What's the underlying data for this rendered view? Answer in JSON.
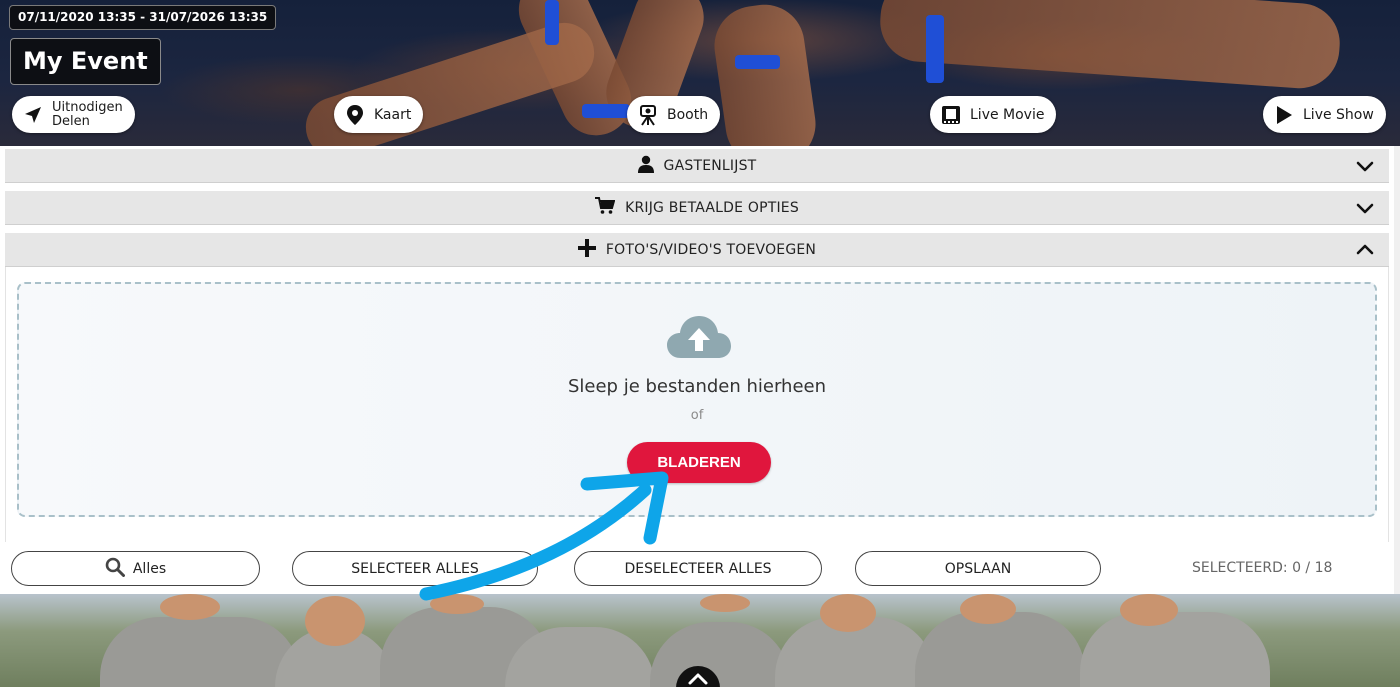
{
  "header": {
    "date_range": "07/11/2020 13:35 - 31/07/2026 13:35",
    "event_title": "My Event",
    "actions": {
      "invite_line1": "Uitnodigen",
      "invite_line2": "Delen",
      "map": "Kaart",
      "booth": "Booth",
      "live_movie": "Live Movie",
      "live_show": "Live Show"
    },
    "icons": {
      "invite": "paper-plane-icon",
      "map": "map-pin-icon",
      "booth": "camera-tripod-icon",
      "live_movie": "film-icon",
      "live_show": "play-icon"
    }
  },
  "accordion": {
    "guestlist": {
      "label": "GASTENLIJST",
      "icon": "user-icon",
      "expanded": false
    },
    "paid_options": {
      "label": "KRIJG BETAALDE OPTIES",
      "icon": "cart-icon",
      "expanded": false
    },
    "add_media": {
      "label": "FOTO'S/VIDEO'S TOEVOEGEN",
      "icon": "plus-icon",
      "expanded": true
    }
  },
  "upload": {
    "icon": "cloud-upload-icon",
    "drop_text": "Sleep je bestanden hierheen",
    "or_text": "of",
    "browse_label": "BLADEREN"
  },
  "toolbar": {
    "filter_label": "Alles",
    "select_all_label": "SELECTEER ALLES",
    "deselect_all_label": "DESELECTEER ALLES",
    "save_label": "OPSLAAN",
    "selected_count": "SELECTEERD: 0 / 18"
  },
  "colors": {
    "accent_red": "#e0163d",
    "annotation_arrow": "#0ea5e9",
    "accordion_bg": "#e6e6e6",
    "dropzone_border": "#a9c0c9"
  }
}
